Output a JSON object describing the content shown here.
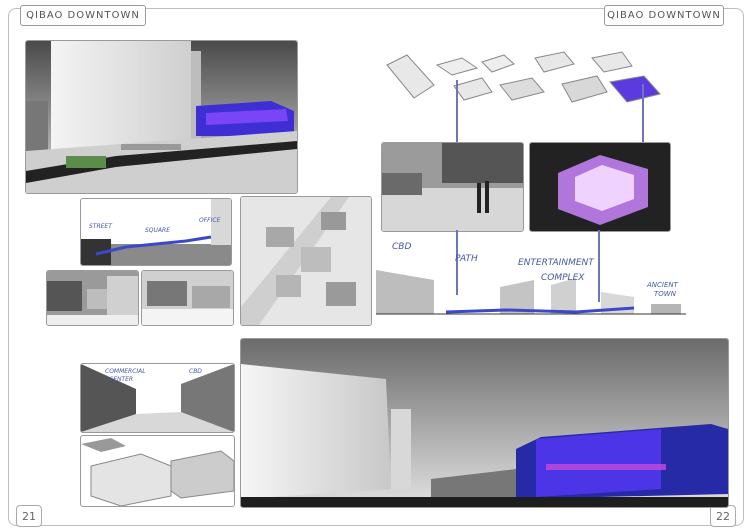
{
  "page": {
    "title_left": "QIBAO DOWNTOWN",
    "title_right": "QIBAO DOWNTOWN",
    "page_left": "21",
    "page_right": "22"
  },
  "annotations": {
    "cbd": "CBD",
    "path": "PATH",
    "entertainment_line1": "ENTERTAINMENT",
    "entertainment_line2": "COMPLEX",
    "ancient_line1": "ANCIENT",
    "ancient_line2": "TOWN",
    "section_street": "STREET",
    "section_square": "SQUARE",
    "section_office": "OFFICE",
    "sketch_commercial_line1": "COMMERCIAL",
    "sketch_commercial_line2": "CENTER",
    "sketch_cbd": "CBD"
  },
  "colors": {
    "accent_purple": "#6a3fd1",
    "accent_blue": "#3b49c9",
    "annotation_ink": "#4757a8"
  }
}
